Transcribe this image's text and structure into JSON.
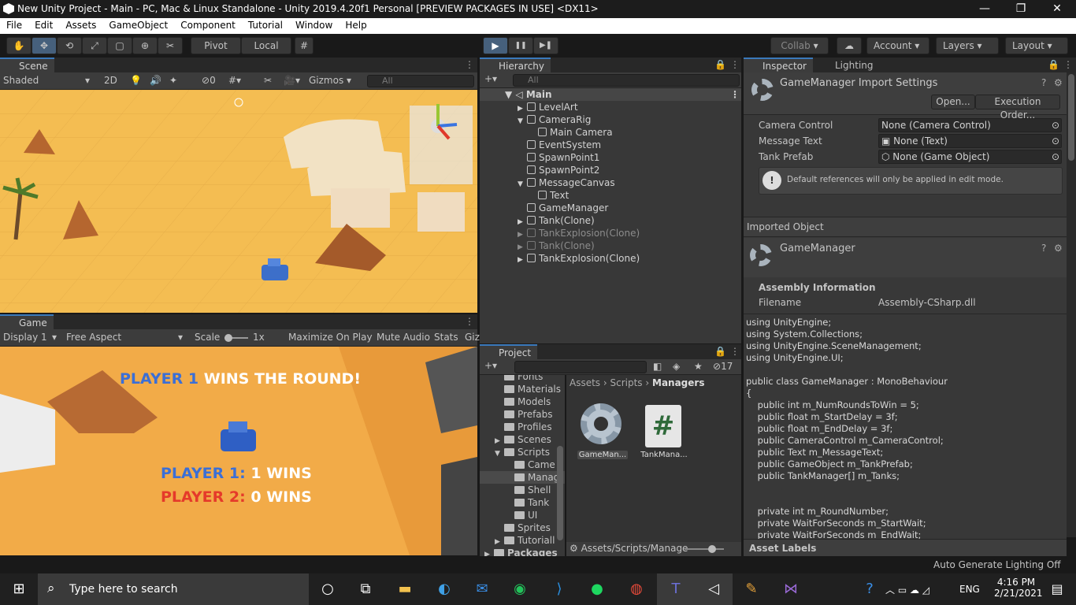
{
  "window": {
    "title": "New Unity Project - Main - PC, Mac & Linux Standalone - Unity 2019.4.20f1 Personal [PREVIEW PACKAGES IN USE] <DX11>",
    "minimize": "—",
    "restore": "❐",
    "close": "✕"
  },
  "menu": [
    "File",
    "Edit",
    "Assets",
    "GameObject",
    "Component",
    "Tutorial",
    "Window",
    "Help"
  ],
  "toolbar": {
    "pivot": "Pivot",
    "local": "Local",
    "collab": "Collab",
    "account": "Account",
    "layers": "Layers",
    "layout": "Layout",
    "play": "▶",
    "pause": "❚❚",
    "step": "▶❚"
  },
  "scene": {
    "tab": "Scene",
    "shading": "Shaded",
    "mode2d": "2D",
    "hidden_count": "0",
    "gizmos": "Gizmos",
    "search_placeholder": "All"
  },
  "game": {
    "tab": "Game",
    "display": "Display 1",
    "aspect": "Free Aspect",
    "scale_label": "Scale",
    "scale_value": "1x",
    "maximize": "Maximize On Play",
    "mute": "Mute Audio",
    "stats": "Stats",
    "gizmos": "Giz",
    "banner_p1": "PLAYER 1",
    "banner_rest": "WINS THE ROUND!",
    "score1_name": "PLAYER 1:",
    "score1_val": "1 WINS",
    "score2_name": "PLAYER 2:",
    "score2_val": "0 WINS",
    "colors": {
      "p1": "#3b6fd6",
      "p2": "#e53a2a"
    }
  },
  "hierarchy": {
    "tab": "Hierarchy",
    "search_placeholder": "All",
    "scene_name": "Main",
    "items": [
      {
        "label": "LevelArt",
        "indent": 1,
        "arrow": "▶",
        "dim": false
      },
      {
        "label": "CameraRig",
        "indent": 1,
        "arrow": "▼",
        "dim": false
      },
      {
        "label": "Main Camera",
        "indent": 2,
        "arrow": "",
        "dim": false
      },
      {
        "label": "EventSystem",
        "indent": 1,
        "arrow": "",
        "dim": false
      },
      {
        "label": "SpawnPoint1",
        "indent": 1,
        "arrow": "",
        "dim": false
      },
      {
        "label": "SpawnPoint2",
        "indent": 1,
        "arrow": "",
        "dim": false
      },
      {
        "label": "MessageCanvas",
        "indent": 1,
        "arrow": "▼",
        "dim": false
      },
      {
        "label": "Text",
        "indent": 2,
        "arrow": "",
        "dim": false
      },
      {
        "label": "GameManager",
        "indent": 1,
        "arrow": "",
        "dim": false
      },
      {
        "label": "Tank(Clone)",
        "indent": 1,
        "arrow": "▶",
        "dim": false
      },
      {
        "label": "TankExplosion(Clone)",
        "indent": 1,
        "arrow": "▶",
        "dim": true
      },
      {
        "label": "Tank(Clone)",
        "indent": 1,
        "arrow": "▶",
        "dim": true
      },
      {
        "label": "TankExplosion(Clone)",
        "indent": 1,
        "arrow": "▶",
        "dim": false
      }
    ]
  },
  "project": {
    "tab": "Project",
    "hidden_count": "17",
    "breadcrumb": [
      "Assets",
      "Scripts",
      "Managers"
    ],
    "footer_path": "Assets/Scripts/Manage",
    "tree": [
      {
        "label": "Fonts",
        "indent": 1,
        "arrow": ""
      },
      {
        "label": "Materials",
        "indent": 1,
        "arrow": ""
      },
      {
        "label": "Models",
        "indent": 1,
        "arrow": ""
      },
      {
        "label": "Prefabs",
        "indent": 1,
        "arrow": ""
      },
      {
        "label": "Profiles",
        "indent": 1,
        "arrow": ""
      },
      {
        "label": "Scenes",
        "indent": 1,
        "arrow": "▶"
      },
      {
        "label": "Scripts",
        "indent": 1,
        "arrow": "▼"
      },
      {
        "label": "Came",
        "indent": 2,
        "arrow": ""
      },
      {
        "label": "Manag",
        "indent": 2,
        "arrow": ""
      },
      {
        "label": "Shell",
        "indent": 2,
        "arrow": ""
      },
      {
        "label": "Tank",
        "indent": 2,
        "arrow": ""
      },
      {
        "label": "UI",
        "indent": 2,
        "arrow": ""
      },
      {
        "label": "Sprites",
        "indent": 1,
        "arrow": ""
      },
      {
        "label": "Tutoriall",
        "indent": 1,
        "arrow": "▶"
      },
      {
        "label": "Packages",
        "indent": 0,
        "arrow": "▶"
      }
    ],
    "assets": [
      {
        "label": "GameMan...",
        "icon": "gear"
      },
      {
        "label": "TankMana...",
        "icon": "#"
      }
    ]
  },
  "inspector": {
    "tab": "Inspector",
    "lighting_tab": "Lighting",
    "header": "GameManager Import Settings",
    "open_btn": "Open...",
    "exec_btn": "Execution Order...",
    "fields": [
      {
        "label": "Camera Control",
        "value": "None (Camera Control)"
      },
      {
        "label": "Message Text",
        "value": "None (Text)"
      },
      {
        "label": "Tank Prefab",
        "value": "None (Game Object)"
      }
    ],
    "info": "Default references will only be applied in edit mode.",
    "imported_object": "Imported Object",
    "object_name": "GameManager",
    "assembly_title": "Assembly Information",
    "filename_label": "Filename",
    "filename_value": "Assembly-CSharp.dll",
    "code": "using UnityEngine;\nusing System.Collections;\nusing UnityEngine.SceneManagement;\nusing UnityEngine.UI;\n\npublic class GameManager : MonoBehaviour\n{\n    public int m_NumRoundsToWin = 5;\n    public float m_StartDelay = 3f;\n    public float m_EndDelay = 3f;\n    public CameraControl m_CameraControl;\n    public Text m_MessageText;\n    public GameObject m_TankPrefab;\n    public TankManager[] m_Tanks;\n\n\n    private int m_RoundNumber;\n    private WaitForSeconds m_StartWait;\n    private WaitForSeconds m_EndWait;",
    "asset_labels": "Asset Labels"
  },
  "status": {
    "text": "Auto Generate Lighting Off"
  },
  "taskbar": {
    "search_placeholder": "Type here to search",
    "lang": "ENG",
    "time": "4:16 PM",
    "date": "2/21/2021"
  }
}
